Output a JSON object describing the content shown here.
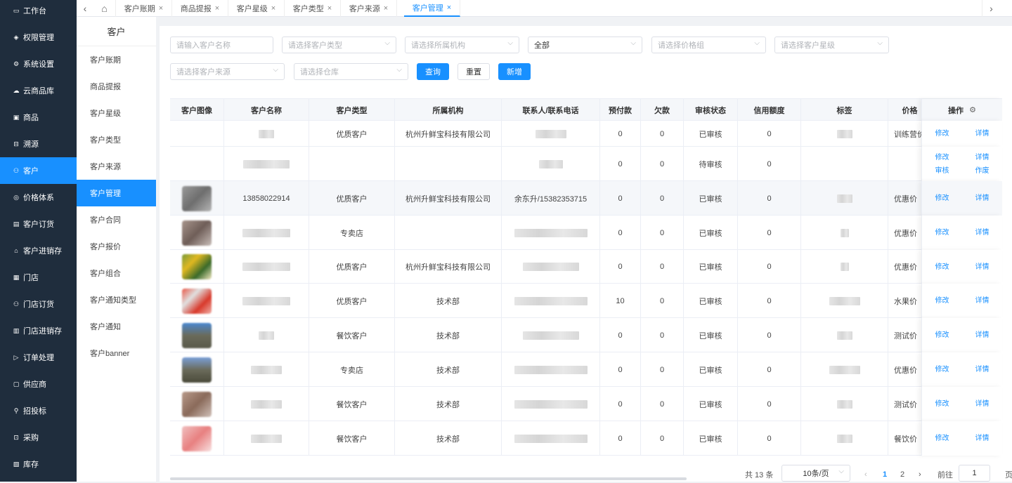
{
  "sidebar": {
    "items": [
      {
        "icon": "monitor-icon",
        "glyph": "▭",
        "label": "工作台"
      },
      {
        "icon": "shield-icon",
        "glyph": "◈",
        "label": "权限管理"
      },
      {
        "icon": "gear-icon",
        "glyph": "⚙",
        "label": "系统设置"
      },
      {
        "icon": "cloud-icon",
        "glyph": "☁",
        "label": "云商品库"
      },
      {
        "icon": "box-icon",
        "glyph": "▣",
        "label": "商品"
      },
      {
        "icon": "trace-icon",
        "glyph": "⊟",
        "label": "溯源"
      },
      {
        "icon": "users-icon",
        "glyph": "⚇",
        "label": "客户",
        "active": true
      },
      {
        "icon": "price-icon",
        "glyph": "◎",
        "label": "价格体系"
      },
      {
        "icon": "order-icon",
        "glyph": "▤",
        "label": "客户订货"
      },
      {
        "icon": "warehouse-icon",
        "glyph": "⌂",
        "label": "客户进销存"
      },
      {
        "icon": "store-icon",
        "glyph": "▦",
        "label": "门店"
      },
      {
        "icon": "store-order-icon",
        "glyph": "⚇",
        "label": "门店订货"
      },
      {
        "icon": "store-stock-icon",
        "glyph": "▥",
        "label": "门店进销存"
      },
      {
        "icon": "send-icon",
        "glyph": "▷",
        "label": "订单处理"
      },
      {
        "icon": "supplier-icon",
        "glyph": "▢",
        "label": "供应商"
      },
      {
        "icon": "bid-icon",
        "glyph": "⚲",
        "label": "招投标"
      },
      {
        "icon": "purchase-icon",
        "glyph": "⊡",
        "label": "采购"
      },
      {
        "icon": "stock-icon",
        "glyph": "▧",
        "label": "库存"
      }
    ]
  },
  "tabs": [
    {
      "label": "客户账期"
    },
    {
      "label": "商品提报"
    },
    {
      "label": "客户星级"
    },
    {
      "label": "客户类型"
    },
    {
      "label": "客户来源"
    },
    {
      "label": "客户管理",
      "active": true
    }
  ],
  "subnav": {
    "title": "客户",
    "items": [
      "客户账期",
      "商品提报",
      "客户星级",
      "客户类型",
      "客户来源",
      "客户管理",
      "客户合同",
      "客户报价",
      "客户组合",
      "客户通知类型",
      "客户通知",
      "客户banner"
    ],
    "active_index": 5
  },
  "filters": {
    "customer_name": "请输入客户名称",
    "customer_type": "请选择客户类型",
    "org": "请选择所属机构",
    "status": "全部",
    "price_group": "请选择价格组",
    "star": "请选择客户星级",
    "source": "请选择客户来源",
    "warehouse": "请选择仓库",
    "query": "查询",
    "reset": "重置",
    "add": "新增"
  },
  "table": {
    "headers": [
      "客户图像",
      "客户名称",
      "客户类型",
      "所属机构",
      "联系人/联系电话",
      "预付款",
      "欠款",
      "审核状态",
      "信用额度",
      "标签",
      "价格"
    ],
    "op_header": "操作",
    "rows": [
      {
        "name": "",
        "type": "优质客户",
        "org": "杭州升鲜宝科技有限公司",
        "contact": "",
        "prepay": "0",
        "debt": "0",
        "status": "已审核",
        "credit": "0",
        "price": "训练营价",
        "ops": [
          "修改",
          "详情"
        ]
      },
      {
        "name": "",
        "type": "",
        "org": "",
        "contact": "",
        "prepay": "0",
        "debt": "0",
        "status": "待审核",
        "credit": "0",
        "price": "",
        "ops": [
          "修改",
          "详情",
          "审核",
          "作废"
        ]
      },
      {
        "name": "13858022914",
        "type": "优质客户",
        "org": "杭州升鲜宝科技有限公司",
        "contact": "余东升/15382353715",
        "prepay": "0",
        "debt": "0",
        "status": "已审核",
        "credit": "0",
        "price": "优惠价",
        "ops": [
          "修改",
          "详情"
        ]
      },
      {
        "name": "",
        "type": "专卖店",
        "org": "",
        "contact": "",
        "prepay": "0",
        "debt": "0",
        "status": "已审核",
        "credit": "0",
        "price": "优惠价",
        "ops": [
          "修改",
          "详情"
        ]
      },
      {
        "name": "",
        "type": "优质客户",
        "org": "杭州升鲜宝科技有限公司",
        "contact": "",
        "prepay": "0",
        "debt": "0",
        "status": "已审核",
        "credit": "0",
        "price": "优惠价",
        "ops": [
          "修改",
          "详情"
        ]
      },
      {
        "name": "",
        "type": "优质客户",
        "org": "技术部",
        "contact": "",
        "prepay": "10",
        "debt": "0",
        "status": "已审核",
        "credit": "0",
        "price": "水果价",
        "ops": [
          "修改",
          "详情"
        ]
      },
      {
        "name": "",
        "type": "餐饮客户",
        "org": "技术部",
        "contact": "",
        "prepay": "0",
        "debt": "0",
        "status": "已审核",
        "credit": "0",
        "price": "测试价",
        "ops": [
          "修改",
          "详情"
        ]
      },
      {
        "name": "",
        "type": "专卖店",
        "org": "技术部",
        "contact": "",
        "prepay": "0",
        "debt": "0",
        "status": "已审核",
        "credit": "0",
        "price": "优惠价",
        "ops": [
          "修改",
          "详情"
        ]
      },
      {
        "name": "",
        "type": "餐饮客户",
        "org": "技术部",
        "contact": "",
        "prepay": "0",
        "debt": "0",
        "status": "已审核",
        "credit": "0",
        "price": "测试价",
        "ops": [
          "修改",
          "详情"
        ]
      },
      {
        "name": "",
        "type": "餐饮客户",
        "org": "技术部",
        "contact": "",
        "prepay": "0",
        "debt": "0",
        "status": "已审核",
        "credit": "0",
        "price": "餐饮价",
        "ops": [
          "修改",
          "详情"
        ]
      }
    ]
  },
  "pagination": {
    "total": "共 13 条",
    "page_size": "10条/页",
    "pages": [
      "1",
      "2"
    ],
    "current": "1",
    "goto_label": "前往",
    "goto_value": "1",
    "page_suffix": "页"
  },
  "colors": {
    "primary": "#1890ff",
    "sidebar_bg": "#1f2d3d"
  }
}
